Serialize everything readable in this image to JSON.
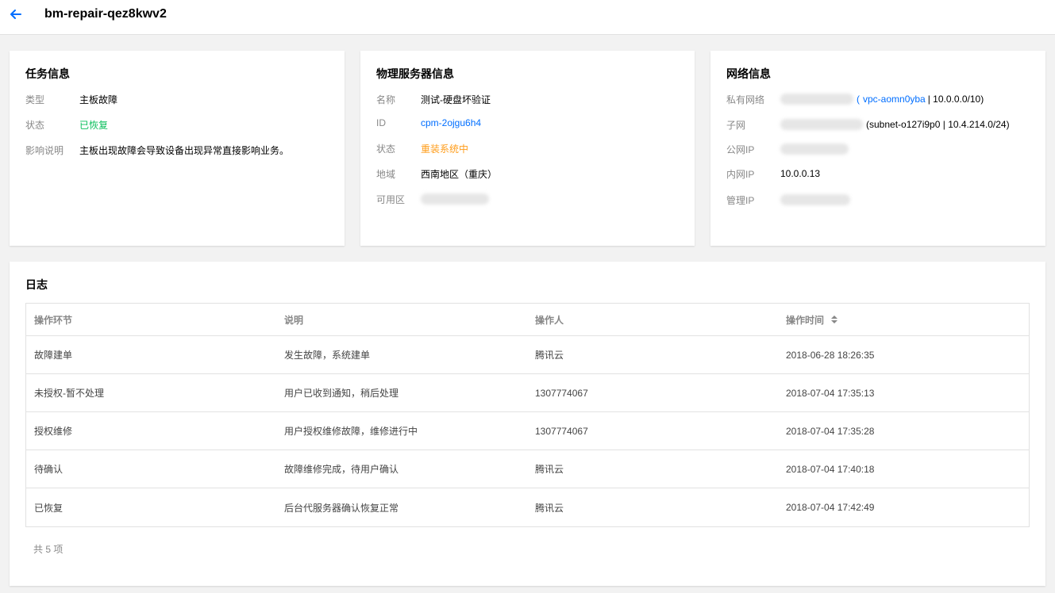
{
  "header": {
    "title": "bm-repair-qez8kwv2"
  },
  "task_info": {
    "title": "任务信息",
    "rows": [
      {
        "label": "类型",
        "value": "主板故障"
      },
      {
        "label": "状态",
        "value": "已恢复"
      },
      {
        "label": "影响说明",
        "value": "主板出现故障会导致设备出现异常直接影响业务。"
      }
    ]
  },
  "server_info": {
    "title": "物理服务器信息",
    "rows": [
      {
        "label": "名称",
        "value": "测试-硬盘坏验证"
      },
      {
        "label": "ID",
        "value": "cpm-2ojgu6h4"
      },
      {
        "label": "状态",
        "value": "重装系统中"
      },
      {
        "label": "地域",
        "value": "西南地区（重庆）"
      },
      {
        "label": "可用区",
        "value": ""
      }
    ]
  },
  "network_info": {
    "title": "网络信息",
    "private_network": {
      "label": "私有网络",
      "open_paren": "(",
      "vpc_id": "vpc-aomn0yba",
      "rest": "| 10.0.0.0/10)"
    },
    "subnet": {
      "label": "子网",
      "rest": "(subnet-o127i9p0 | 10.4.214.0/24)"
    },
    "public_ip": {
      "label": "公网IP"
    },
    "private_ip": {
      "label": "内网IP",
      "value": "10.0.0.13"
    },
    "mgmt_ip": {
      "label": "管理IP"
    }
  },
  "log": {
    "title": "日志",
    "columns": [
      "操作环节",
      "说明",
      "操作人",
      "操作时间"
    ],
    "rows": [
      [
        "故障建单",
        "发生故障，系统建单",
        "腾讯云",
        "2018-06-28 18:26:35"
      ],
      [
        "未授权-暂不处理",
        "用户已收到通知，稍后处理",
        "1307774067",
        "2018-07-04 17:35:13"
      ],
      [
        "授权维修",
        "用户授权维修故障，维修进行中",
        "1307774067",
        "2018-07-04 17:35:28"
      ],
      [
        "待确认",
        "故障维修完成，待用户确认",
        "腾讯云",
        "2018-07-04 17:40:18"
      ],
      [
        "已恢复",
        "后台代服务器确认恢复正常",
        "腾讯云",
        "2018-07-04 17:42:49"
      ]
    ],
    "total": "共 5 项"
  },
  "colors": {
    "accent": "#006eff",
    "success": "#0abf5b",
    "warning": "#ff9c19"
  }
}
